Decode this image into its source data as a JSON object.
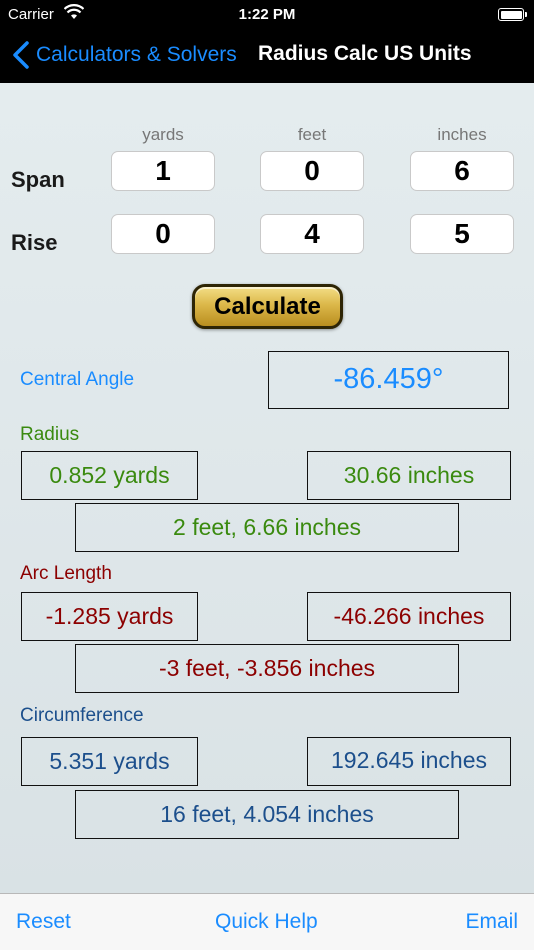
{
  "status": {
    "carrier": "Carrier",
    "time": "1:22 PM"
  },
  "nav": {
    "back_label": "Calculators & Solvers",
    "title": "Radius Calc US Units"
  },
  "units": {
    "yards": "yards",
    "feet": "feet",
    "inches": "inches"
  },
  "span": {
    "label": "Span",
    "yards": "1",
    "feet": "0",
    "inches": "6"
  },
  "rise": {
    "label": "Rise",
    "yards": "0",
    "feet": "4",
    "inches": "5"
  },
  "calculate_label": "Calculate",
  "central_angle": {
    "label": "Central Angle",
    "value": "-86.459°"
  },
  "radius": {
    "label": "Radius",
    "yards": "0.852 yards",
    "inches": "30.66 inches",
    "feet_inches": "2 feet, 6.66 inches"
  },
  "arc_length": {
    "label": "Arc Length",
    "yards": "-1.285 yards",
    "inches": "-46.266 inches",
    "feet_inches": "-3 feet, -3.856 inches"
  },
  "circumference": {
    "label": "Circumference",
    "yards": "5.351 yards",
    "inches": "192.645 inches",
    "feet_inches": "16 feet, 4.054 inches"
  },
  "toolbar": {
    "reset": "Reset",
    "quick_help": "Quick Help",
    "email": "Email"
  },
  "colors": {
    "accent": "#1a8cff",
    "radius": "#3a8a0f",
    "arc": "#8c0000",
    "circumference": "#1c4f8c"
  }
}
